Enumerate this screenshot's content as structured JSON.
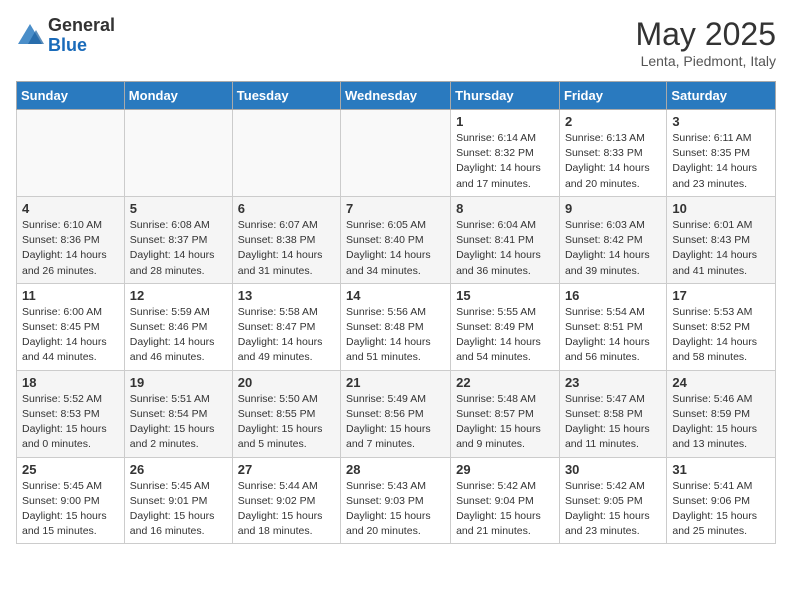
{
  "header": {
    "logo_general": "General",
    "logo_blue": "Blue",
    "month_title": "May 2025",
    "subtitle": "Lenta, Piedmont, Italy"
  },
  "weekdays": [
    "Sunday",
    "Monday",
    "Tuesday",
    "Wednesday",
    "Thursday",
    "Friday",
    "Saturday"
  ],
  "weeks": [
    [
      {
        "day": "",
        "info": ""
      },
      {
        "day": "",
        "info": ""
      },
      {
        "day": "",
        "info": ""
      },
      {
        "day": "",
        "info": ""
      },
      {
        "day": "1",
        "info": "Sunrise: 6:14 AM\nSunset: 8:32 PM\nDaylight: 14 hours and 17 minutes."
      },
      {
        "day": "2",
        "info": "Sunrise: 6:13 AM\nSunset: 8:33 PM\nDaylight: 14 hours and 20 minutes."
      },
      {
        "day": "3",
        "info": "Sunrise: 6:11 AM\nSunset: 8:35 PM\nDaylight: 14 hours and 23 minutes."
      }
    ],
    [
      {
        "day": "4",
        "info": "Sunrise: 6:10 AM\nSunset: 8:36 PM\nDaylight: 14 hours and 26 minutes."
      },
      {
        "day": "5",
        "info": "Sunrise: 6:08 AM\nSunset: 8:37 PM\nDaylight: 14 hours and 28 minutes."
      },
      {
        "day": "6",
        "info": "Sunrise: 6:07 AM\nSunset: 8:38 PM\nDaylight: 14 hours and 31 minutes."
      },
      {
        "day": "7",
        "info": "Sunrise: 6:05 AM\nSunset: 8:40 PM\nDaylight: 14 hours and 34 minutes."
      },
      {
        "day": "8",
        "info": "Sunrise: 6:04 AM\nSunset: 8:41 PM\nDaylight: 14 hours and 36 minutes."
      },
      {
        "day": "9",
        "info": "Sunrise: 6:03 AM\nSunset: 8:42 PM\nDaylight: 14 hours and 39 minutes."
      },
      {
        "day": "10",
        "info": "Sunrise: 6:01 AM\nSunset: 8:43 PM\nDaylight: 14 hours and 41 minutes."
      }
    ],
    [
      {
        "day": "11",
        "info": "Sunrise: 6:00 AM\nSunset: 8:45 PM\nDaylight: 14 hours and 44 minutes."
      },
      {
        "day": "12",
        "info": "Sunrise: 5:59 AM\nSunset: 8:46 PM\nDaylight: 14 hours and 46 minutes."
      },
      {
        "day": "13",
        "info": "Sunrise: 5:58 AM\nSunset: 8:47 PM\nDaylight: 14 hours and 49 minutes."
      },
      {
        "day": "14",
        "info": "Sunrise: 5:56 AM\nSunset: 8:48 PM\nDaylight: 14 hours and 51 minutes."
      },
      {
        "day": "15",
        "info": "Sunrise: 5:55 AM\nSunset: 8:49 PM\nDaylight: 14 hours and 54 minutes."
      },
      {
        "day": "16",
        "info": "Sunrise: 5:54 AM\nSunset: 8:51 PM\nDaylight: 14 hours and 56 minutes."
      },
      {
        "day": "17",
        "info": "Sunrise: 5:53 AM\nSunset: 8:52 PM\nDaylight: 14 hours and 58 minutes."
      }
    ],
    [
      {
        "day": "18",
        "info": "Sunrise: 5:52 AM\nSunset: 8:53 PM\nDaylight: 15 hours and 0 minutes."
      },
      {
        "day": "19",
        "info": "Sunrise: 5:51 AM\nSunset: 8:54 PM\nDaylight: 15 hours and 2 minutes."
      },
      {
        "day": "20",
        "info": "Sunrise: 5:50 AM\nSunset: 8:55 PM\nDaylight: 15 hours and 5 minutes."
      },
      {
        "day": "21",
        "info": "Sunrise: 5:49 AM\nSunset: 8:56 PM\nDaylight: 15 hours and 7 minutes."
      },
      {
        "day": "22",
        "info": "Sunrise: 5:48 AM\nSunset: 8:57 PM\nDaylight: 15 hours and 9 minutes."
      },
      {
        "day": "23",
        "info": "Sunrise: 5:47 AM\nSunset: 8:58 PM\nDaylight: 15 hours and 11 minutes."
      },
      {
        "day": "24",
        "info": "Sunrise: 5:46 AM\nSunset: 8:59 PM\nDaylight: 15 hours and 13 minutes."
      }
    ],
    [
      {
        "day": "25",
        "info": "Sunrise: 5:45 AM\nSunset: 9:00 PM\nDaylight: 15 hours and 15 minutes."
      },
      {
        "day": "26",
        "info": "Sunrise: 5:45 AM\nSunset: 9:01 PM\nDaylight: 15 hours and 16 minutes."
      },
      {
        "day": "27",
        "info": "Sunrise: 5:44 AM\nSunset: 9:02 PM\nDaylight: 15 hours and 18 minutes."
      },
      {
        "day": "28",
        "info": "Sunrise: 5:43 AM\nSunset: 9:03 PM\nDaylight: 15 hours and 20 minutes."
      },
      {
        "day": "29",
        "info": "Sunrise: 5:42 AM\nSunset: 9:04 PM\nDaylight: 15 hours and 21 minutes."
      },
      {
        "day": "30",
        "info": "Sunrise: 5:42 AM\nSunset: 9:05 PM\nDaylight: 15 hours and 23 minutes."
      },
      {
        "day": "31",
        "info": "Sunrise: 5:41 AM\nSunset: 9:06 PM\nDaylight: 15 hours and 25 minutes."
      }
    ]
  ]
}
